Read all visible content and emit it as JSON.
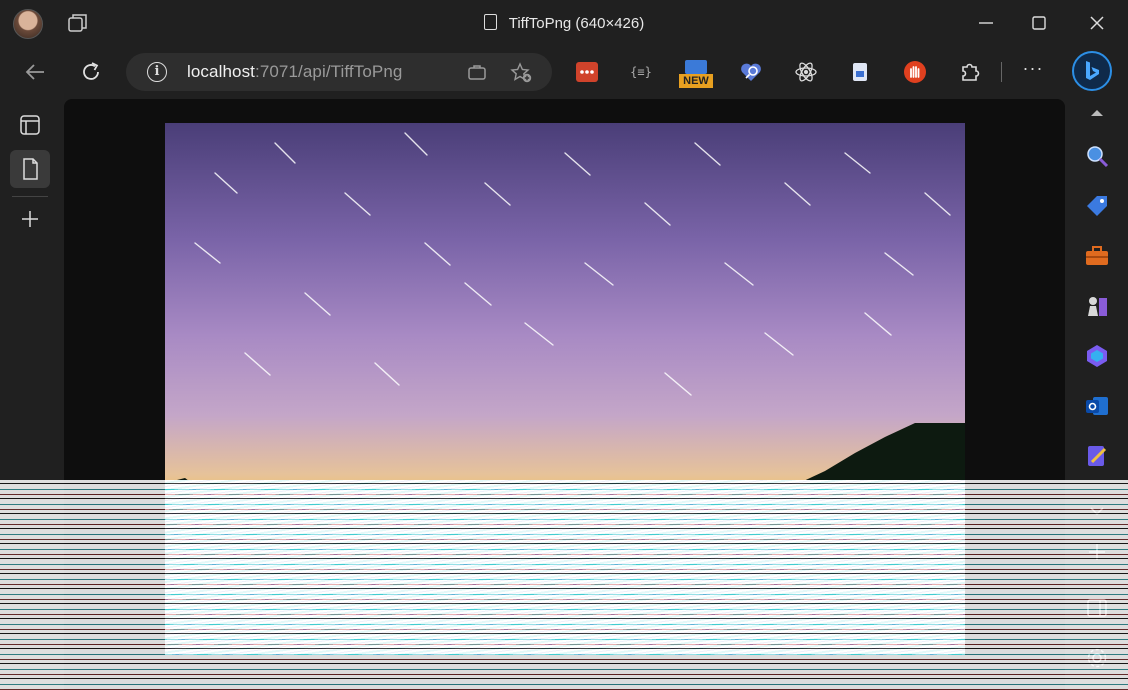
{
  "window": {
    "title": "TiffToPng (640×426)"
  },
  "address_bar": {
    "host": "localhost",
    "path": ":7071/api/TiffToPng"
  },
  "extensions": [
    {
      "name": "ext-red-dots-icon",
      "color": "#d0432b"
    },
    {
      "name": "ext-json-braces-icon",
      "label": "{≡}"
    },
    {
      "name": "ext-new-badge-icon",
      "label": "NEW"
    },
    {
      "name": "ext-heart-search-icon"
    },
    {
      "name": "ext-react-icon"
    },
    {
      "name": "ext-save-page-icon"
    },
    {
      "name": "ext-stop-hand-icon",
      "color": "#e0401f"
    },
    {
      "name": "extensions-puzzle-icon"
    }
  ],
  "more_label": "···",
  "colors": {
    "chrome_bg": "#202020",
    "addr_bg": "#2e2e2e",
    "accent": "#2c8fe6"
  }
}
